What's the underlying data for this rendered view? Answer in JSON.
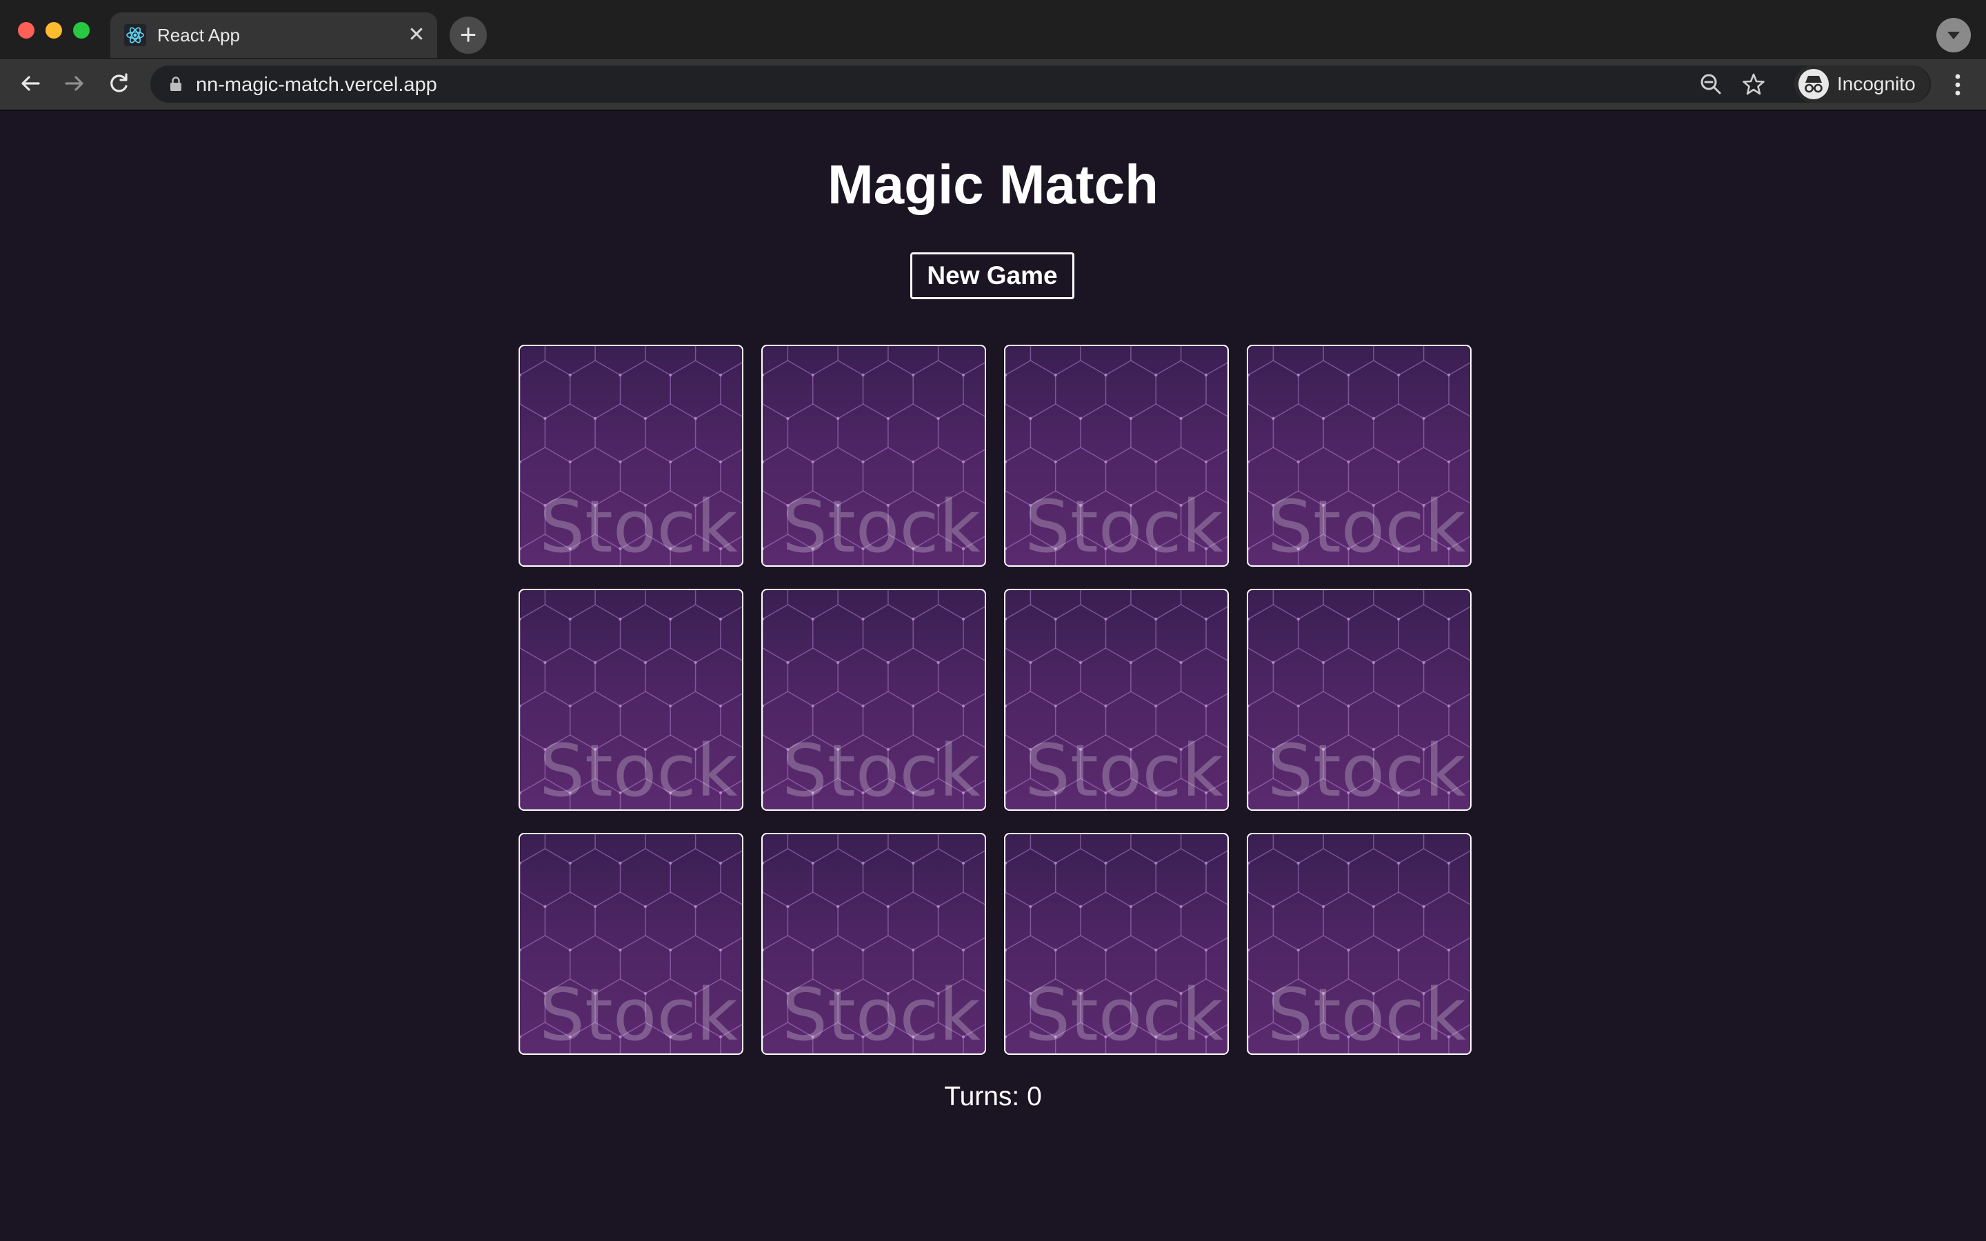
{
  "browser": {
    "tab_title": "React App",
    "url": "nn-magic-match.vercel.app",
    "profile_label": "Incognito"
  },
  "app": {
    "title": "Magic Match",
    "new_game_label": "New Game",
    "turns_label": "Turns: 0",
    "card_back_watermark": "Stock"
  },
  "cards": [
    {
      "state": "face-down"
    },
    {
      "state": "face-down"
    },
    {
      "state": "face-down"
    },
    {
      "state": "face-down"
    },
    {
      "state": "face-down"
    },
    {
      "state": "face-down"
    },
    {
      "state": "face-down"
    },
    {
      "state": "face-down"
    },
    {
      "state": "face-down"
    },
    {
      "state": "face-down"
    },
    {
      "state": "face-down"
    },
    {
      "state": "face-down"
    }
  ],
  "colors": {
    "page_background": "#1b1523",
    "card_back": "#4d2563",
    "card_border": "#ffffff",
    "text": "#ffffff"
  },
  "icons": [
    "react-favicon",
    "close-icon",
    "plus-icon",
    "tab-search-icon",
    "back-arrow-icon",
    "forward-arrow-icon",
    "reload-icon",
    "lock-icon",
    "zoom-out-icon",
    "star-icon",
    "incognito-icon",
    "more-vert-icon"
  ]
}
